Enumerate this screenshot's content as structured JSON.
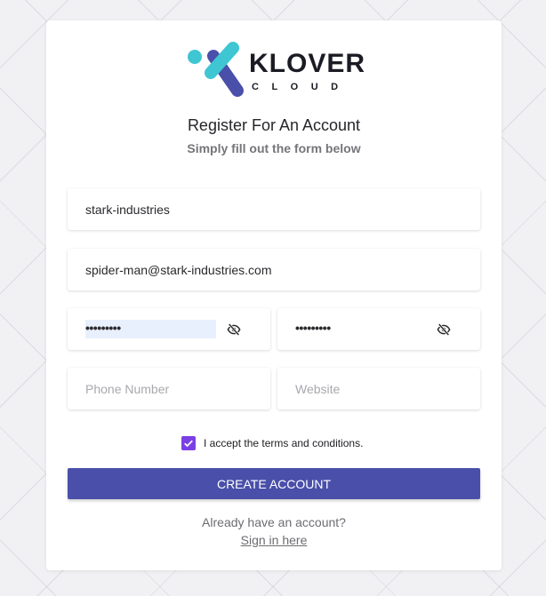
{
  "brand": {
    "name": "KLOVER",
    "sub": "CLOUD",
    "colors": {
      "teal": "#3ec6d3",
      "indigo": "#4a4faa",
      "text": "#1b1b24"
    }
  },
  "header": {
    "title": "Register For An Account",
    "subtitle": "Simply fill out the form below"
  },
  "form": {
    "company": {
      "value": "stark-industries",
      "placeholder": ""
    },
    "email": {
      "value": "spider-man@stark-industries.com",
      "placeholder": ""
    },
    "password": {
      "masked": "•••••••••",
      "icon": "eye-off-icon"
    },
    "confirm_password": {
      "masked": "•••••••••",
      "icon": "eye-off-icon"
    },
    "phone": {
      "value": "",
      "placeholder": "Phone Number"
    },
    "website": {
      "value": "",
      "placeholder": "Website"
    },
    "terms": {
      "label": "I accept the terms and conditions.",
      "checked": true,
      "color": "#7b3fe4"
    },
    "submit_label": "CREATE ACCOUNT",
    "submit_color": "#4a4faa"
  },
  "footer": {
    "prompt": "Already have an account?",
    "link": "Sign in here"
  }
}
